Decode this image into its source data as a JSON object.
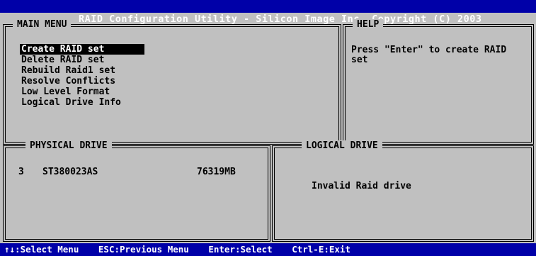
{
  "title": "RAID Configuration Utility - Silicon Image Inc. Copyright (C) 2003",
  "main_menu": {
    "title": "MAIN MENU",
    "items": [
      "Create RAID set",
      "Delete RAID set",
      "Rebuild Raid1 set",
      "Resolve Conflicts",
      "Low Level Format",
      "Logical Drive Info"
    ],
    "selected_index": 0
  },
  "help": {
    "title": "HELP",
    "text": "Press \"Enter\" to create RAID set"
  },
  "physical_drive": {
    "title": "PHYSICAL DRIVE",
    "drives": [
      {
        "index": "3",
        "model": "ST380023AS",
        "size": "76319MB"
      }
    ]
  },
  "logical_drive": {
    "title": "LOGICAL DRIVE",
    "message": "Invalid Raid drive"
  },
  "status_bar": {
    "select": "↑↓:Select Menu",
    "previous": "ESC:Previous Menu",
    "enter": "Enter:Select",
    "exit": "Ctrl-E:Exit"
  }
}
